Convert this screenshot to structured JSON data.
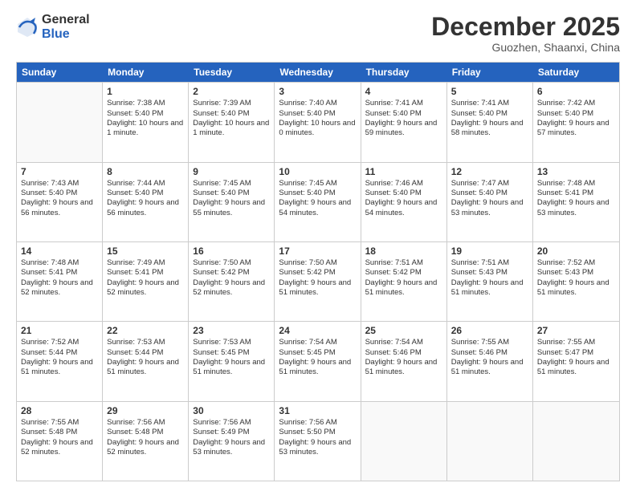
{
  "logo": {
    "general": "General",
    "blue": "Blue"
  },
  "title": "December 2025",
  "location": "Guozhen, Shaanxi, China",
  "days": [
    "Sunday",
    "Monday",
    "Tuesday",
    "Wednesday",
    "Thursday",
    "Friday",
    "Saturday"
  ],
  "weeks": [
    [
      {
        "day": "",
        "empty": true
      },
      {
        "day": "1",
        "sunrise": "Sunrise: 7:38 AM",
        "sunset": "Sunset: 5:40 PM",
        "daylight": "Daylight: 10 hours and 1 minute."
      },
      {
        "day": "2",
        "sunrise": "Sunrise: 7:39 AM",
        "sunset": "Sunset: 5:40 PM",
        "daylight": "Daylight: 10 hours and 1 minute."
      },
      {
        "day": "3",
        "sunrise": "Sunrise: 7:40 AM",
        "sunset": "Sunset: 5:40 PM",
        "daylight": "Daylight: 10 hours and 0 minutes."
      },
      {
        "day": "4",
        "sunrise": "Sunrise: 7:41 AM",
        "sunset": "Sunset: 5:40 PM",
        "daylight": "Daylight: 9 hours and 59 minutes."
      },
      {
        "day": "5",
        "sunrise": "Sunrise: 7:41 AM",
        "sunset": "Sunset: 5:40 PM",
        "daylight": "Daylight: 9 hours and 58 minutes."
      },
      {
        "day": "6",
        "sunrise": "Sunrise: 7:42 AM",
        "sunset": "Sunset: 5:40 PM",
        "daylight": "Daylight: 9 hours and 57 minutes."
      }
    ],
    [
      {
        "day": "7",
        "sunrise": "Sunrise: 7:43 AM",
        "sunset": "Sunset: 5:40 PM",
        "daylight": "Daylight: 9 hours and 56 minutes."
      },
      {
        "day": "8",
        "sunrise": "Sunrise: 7:44 AM",
        "sunset": "Sunset: 5:40 PM",
        "daylight": "Daylight: 9 hours and 56 minutes."
      },
      {
        "day": "9",
        "sunrise": "Sunrise: 7:45 AM",
        "sunset": "Sunset: 5:40 PM",
        "daylight": "Daylight: 9 hours and 55 minutes."
      },
      {
        "day": "10",
        "sunrise": "Sunrise: 7:45 AM",
        "sunset": "Sunset: 5:40 PM",
        "daylight": "Daylight: 9 hours and 54 minutes."
      },
      {
        "day": "11",
        "sunrise": "Sunrise: 7:46 AM",
        "sunset": "Sunset: 5:40 PM",
        "daylight": "Daylight: 9 hours and 54 minutes."
      },
      {
        "day": "12",
        "sunrise": "Sunrise: 7:47 AM",
        "sunset": "Sunset: 5:40 PM",
        "daylight": "Daylight: 9 hours and 53 minutes."
      },
      {
        "day": "13",
        "sunrise": "Sunrise: 7:48 AM",
        "sunset": "Sunset: 5:41 PM",
        "daylight": "Daylight: 9 hours and 53 minutes."
      }
    ],
    [
      {
        "day": "14",
        "sunrise": "Sunrise: 7:48 AM",
        "sunset": "Sunset: 5:41 PM",
        "daylight": "Daylight: 9 hours and 52 minutes."
      },
      {
        "day": "15",
        "sunrise": "Sunrise: 7:49 AM",
        "sunset": "Sunset: 5:41 PM",
        "daylight": "Daylight: 9 hours and 52 minutes."
      },
      {
        "day": "16",
        "sunrise": "Sunrise: 7:50 AM",
        "sunset": "Sunset: 5:42 PM",
        "daylight": "Daylight: 9 hours and 52 minutes."
      },
      {
        "day": "17",
        "sunrise": "Sunrise: 7:50 AM",
        "sunset": "Sunset: 5:42 PM",
        "daylight": "Daylight: 9 hours and 51 minutes."
      },
      {
        "day": "18",
        "sunrise": "Sunrise: 7:51 AM",
        "sunset": "Sunset: 5:42 PM",
        "daylight": "Daylight: 9 hours and 51 minutes."
      },
      {
        "day": "19",
        "sunrise": "Sunrise: 7:51 AM",
        "sunset": "Sunset: 5:43 PM",
        "daylight": "Daylight: 9 hours and 51 minutes."
      },
      {
        "day": "20",
        "sunrise": "Sunrise: 7:52 AM",
        "sunset": "Sunset: 5:43 PM",
        "daylight": "Daylight: 9 hours and 51 minutes."
      }
    ],
    [
      {
        "day": "21",
        "sunrise": "Sunrise: 7:52 AM",
        "sunset": "Sunset: 5:44 PM",
        "daylight": "Daylight: 9 hours and 51 minutes."
      },
      {
        "day": "22",
        "sunrise": "Sunrise: 7:53 AM",
        "sunset": "Sunset: 5:44 PM",
        "daylight": "Daylight: 9 hours and 51 minutes."
      },
      {
        "day": "23",
        "sunrise": "Sunrise: 7:53 AM",
        "sunset": "Sunset: 5:45 PM",
        "daylight": "Daylight: 9 hours and 51 minutes."
      },
      {
        "day": "24",
        "sunrise": "Sunrise: 7:54 AM",
        "sunset": "Sunset: 5:45 PM",
        "daylight": "Daylight: 9 hours and 51 minutes."
      },
      {
        "day": "25",
        "sunrise": "Sunrise: 7:54 AM",
        "sunset": "Sunset: 5:46 PM",
        "daylight": "Daylight: 9 hours and 51 minutes."
      },
      {
        "day": "26",
        "sunrise": "Sunrise: 7:55 AM",
        "sunset": "Sunset: 5:46 PM",
        "daylight": "Daylight: 9 hours and 51 minutes."
      },
      {
        "day": "27",
        "sunrise": "Sunrise: 7:55 AM",
        "sunset": "Sunset: 5:47 PM",
        "daylight": "Daylight: 9 hours and 51 minutes."
      }
    ],
    [
      {
        "day": "28",
        "sunrise": "Sunrise: 7:55 AM",
        "sunset": "Sunset: 5:48 PM",
        "daylight": "Daylight: 9 hours and 52 minutes."
      },
      {
        "day": "29",
        "sunrise": "Sunrise: 7:56 AM",
        "sunset": "Sunset: 5:48 PM",
        "daylight": "Daylight: 9 hours and 52 minutes."
      },
      {
        "day": "30",
        "sunrise": "Sunrise: 7:56 AM",
        "sunset": "Sunset: 5:49 PM",
        "daylight": "Daylight: 9 hours and 53 minutes."
      },
      {
        "day": "31",
        "sunrise": "Sunrise: 7:56 AM",
        "sunset": "Sunset: 5:50 PM",
        "daylight": "Daylight: 9 hours and 53 minutes."
      },
      {
        "day": "",
        "empty": true
      },
      {
        "day": "",
        "empty": true
      },
      {
        "day": "",
        "empty": true
      }
    ]
  ]
}
